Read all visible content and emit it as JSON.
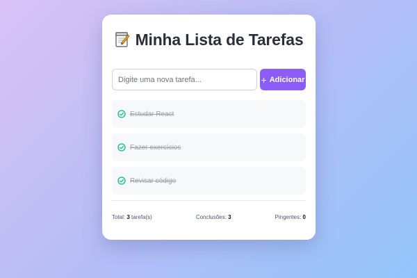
{
  "app": {
    "title_icon": "memo-icon",
    "title": "Minha Lista de Tarefas"
  },
  "form": {
    "placeholder": "Digite uma nova tarefa...",
    "value": "",
    "add_label": "Adicionar",
    "add_icon": "plus-icon"
  },
  "tasks": [
    {
      "label": "Estudar React",
      "completed": true
    },
    {
      "label": "Fazer exercícios",
      "completed": true
    },
    {
      "label": "Revisar código",
      "completed": true
    }
  ],
  "footer": {
    "total_label": "Total:",
    "total_value": "3",
    "total_suffix": "tarefa(s)",
    "done_label": "Conclusões:",
    "done_value": "3",
    "pending_label": "Pingentes:",
    "pending_value": "0"
  },
  "colors": {
    "accent": "#8b5cf6",
    "check": "#10b981"
  }
}
